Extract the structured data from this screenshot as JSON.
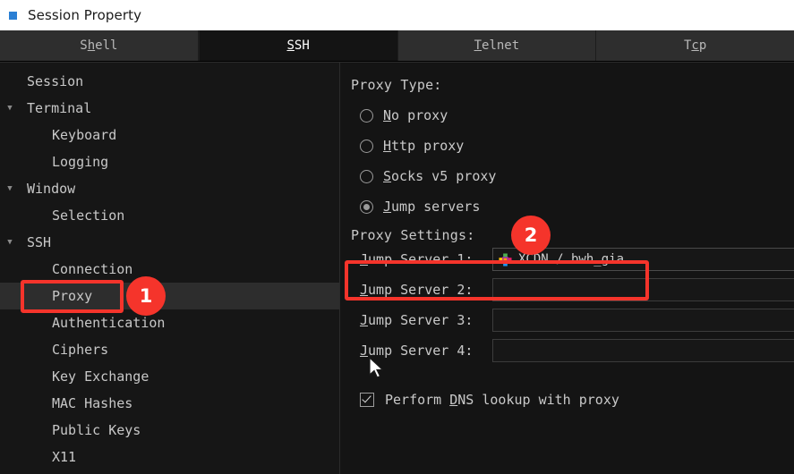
{
  "window": {
    "title": "Session Property",
    "icon": "app-square-icon"
  },
  "tabs": [
    {
      "label": "Shell",
      "mnemonic": "h",
      "active": false
    },
    {
      "label": "SSH",
      "mnemonic": "S",
      "active": true
    },
    {
      "label": "Telnet",
      "mnemonic": "T",
      "active": false
    },
    {
      "label": "Tcp",
      "mnemonic": "c",
      "active": false
    }
  ],
  "sidebar": {
    "items": [
      {
        "label": "Session",
        "level": 0,
        "twisty": "",
        "selected": false
      },
      {
        "label": "Terminal",
        "level": 0,
        "twisty": "▼",
        "selected": false
      },
      {
        "label": "Keyboard",
        "level": 1,
        "twisty": "",
        "selected": false
      },
      {
        "label": "Logging",
        "level": 1,
        "twisty": "",
        "selected": false
      },
      {
        "label": "Window",
        "level": 0,
        "twisty": "▼",
        "selected": false
      },
      {
        "label": "Selection",
        "level": 1,
        "twisty": "",
        "selected": false
      },
      {
        "label": "SSH",
        "level": 0,
        "twisty": "▼",
        "selected": false
      },
      {
        "label": "Connection",
        "level": 1,
        "twisty": "",
        "selected": false
      },
      {
        "label": "Proxy",
        "level": 1,
        "twisty": "",
        "selected": true
      },
      {
        "label": "Authentication",
        "level": 1,
        "twisty": "",
        "selected": false
      },
      {
        "label": "Ciphers",
        "level": 1,
        "twisty": "",
        "selected": false
      },
      {
        "label": "Key Exchange",
        "level": 1,
        "twisty": "",
        "selected": false
      },
      {
        "label": "MAC Hashes",
        "level": 1,
        "twisty": "",
        "selected": false
      },
      {
        "label": "Public Keys",
        "level": 1,
        "twisty": "",
        "selected": false
      },
      {
        "label": "X11",
        "level": 1,
        "twisty": "",
        "selected": false
      }
    ]
  },
  "panel": {
    "proxy_type_label": "Proxy Type:",
    "proxy_types": [
      {
        "label": "No proxy",
        "mnemonic": "N",
        "rest": "o proxy",
        "checked": false
      },
      {
        "label": "Http proxy",
        "mnemonic": "H",
        "rest": "ttp proxy",
        "checked": false
      },
      {
        "label": "Socks v5 proxy",
        "mnemonic": "S",
        "rest": "ocks v5 proxy",
        "checked": false
      },
      {
        "label": "Jump servers",
        "mnemonic": "J",
        "rest": "ump servers",
        "checked": true
      }
    ],
    "proxy_settings_label": "Proxy Settings:",
    "jump_servers": [
      {
        "label_mn": "J",
        "label_rest": "ump Server 1:",
        "value": "XCDN / bwh_gia",
        "has_icon": true
      },
      {
        "label_mn": "J",
        "label_rest": "ump Server 2:",
        "value": "",
        "has_icon": false
      },
      {
        "label_mn": "J",
        "label_rest": "ump Server 3:",
        "value": "",
        "has_icon": false
      },
      {
        "label_mn": "J",
        "label_rest": "ump Server 4:",
        "value": "",
        "has_icon": false
      }
    ],
    "dns_checkbox": {
      "pre": "Perform ",
      "mnemonic": "D",
      "rest": "NS lookup with proxy",
      "checked": true
    }
  },
  "annotations": {
    "accent_color": "#f5342b",
    "badges": [
      {
        "number": "1",
        "target": "sidebar-item-proxy"
      },
      {
        "number": "2",
        "target": "jump-server-1-field"
      }
    ]
  }
}
